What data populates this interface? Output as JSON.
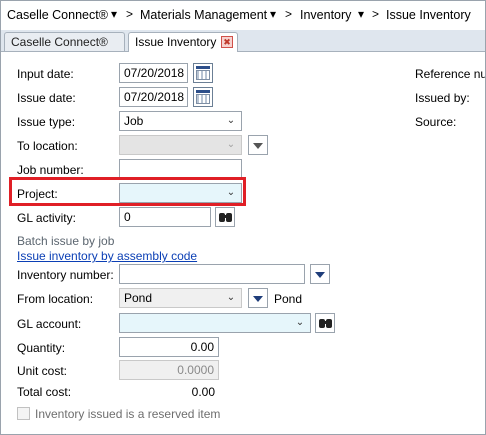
{
  "breadcrumb": {
    "items": [
      "Caselle Connect®",
      "Materials Management",
      "Inventory",
      "Issue Inventory"
    ],
    "separator": ">"
  },
  "tabs": [
    {
      "label": "Caselle Connect®",
      "active": false
    },
    {
      "label": "Issue Inventory",
      "active": true
    }
  ],
  "form": {
    "input_date": {
      "label": "Input date:",
      "value": "07/20/2018"
    },
    "issue_date": {
      "label": "Issue date:",
      "value": "07/20/2018"
    },
    "issue_type": {
      "label": "Issue type:",
      "value": "Job"
    },
    "to_location": {
      "label": "To location:",
      "value": ""
    },
    "job_number": {
      "label": "Job number:",
      "value": ""
    },
    "project": {
      "label": "Project:",
      "value": ""
    },
    "gl_activity": {
      "label": "GL activity:",
      "value": "0"
    },
    "batch_section": "Batch issue by job",
    "assembly_link": "Issue inventory by assembly code",
    "inventory_number": {
      "label": "Inventory number:",
      "value": ""
    },
    "from_location": {
      "label": "From location:",
      "value": "Pond",
      "description": "Pond"
    },
    "gl_account": {
      "label": "GL account:",
      "value": ""
    },
    "quantity": {
      "label": "Quantity:",
      "value": "0.00"
    },
    "unit_cost": {
      "label": "Unit cost:",
      "value": "0.0000"
    },
    "total_cost": {
      "label": "Total cost:",
      "value": "0.00"
    },
    "reserved_checkbox": {
      "label": "Inventory issued is a reserved item",
      "checked": false
    }
  },
  "right_panel": {
    "reference_label": "Reference nu",
    "issued_by_label": "Issued by:",
    "source_label": "Source:"
  },
  "colors": {
    "highlight": "#e01f26",
    "link": "#0b3fb5",
    "tab_bar": "#dfe6ee"
  }
}
